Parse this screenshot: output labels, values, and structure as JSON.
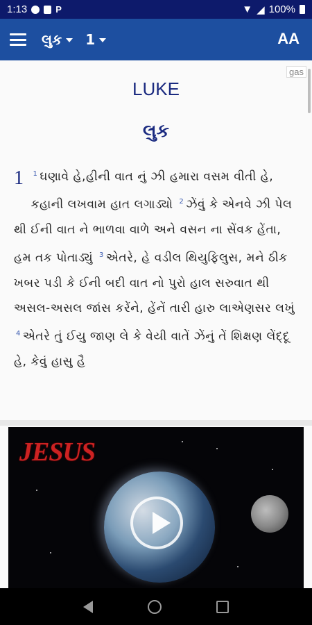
{
  "status": {
    "time": "1:13",
    "battery": "100%"
  },
  "appbar": {
    "book": "લુક",
    "chapter": "1",
    "text_size_label": "AA"
  },
  "content": {
    "lang_tag": "gas",
    "title_en": "LUKE",
    "title_local": "લુક",
    "chapter_number": "1",
    "verses": [
      {
        "num": "1",
        "text": "ઘણાવે હે,હીની વાત નું ઝી હમારા વસમ વીતી હે, કહાની લખવામ હાત લગાડ્યો"
      },
      {
        "num": "2",
        "text": "ઝેંવું કે એનવે ઝી પેલ થી ઈની વાત ને ભાળવા વાળે અને વસન ના સેંવક હેંતા, હમ તક પોતાડ્યું"
      },
      {
        "num": "3",
        "text": "એતરે, હે વડીલ થિયુફિલુસ, મને ઠીક ખબર પડી કે ઈની બદી વાત નો પુરો હાલ સરુવાત થી અસલ-અસલ જાંસ કરેંને, હેંનેં તારી હારુ લાએણસર લખું"
      },
      {
        "num": "4",
        "text": "એતરે તું ઈયુ જાણ લે કે વેયી વાતેં ઝેંનું તેં શિક્ષણ લેંદ્દૂ હે, કેવું હાસુ હૈ"
      }
    ]
  },
  "video": {
    "title": "JESUS"
  }
}
